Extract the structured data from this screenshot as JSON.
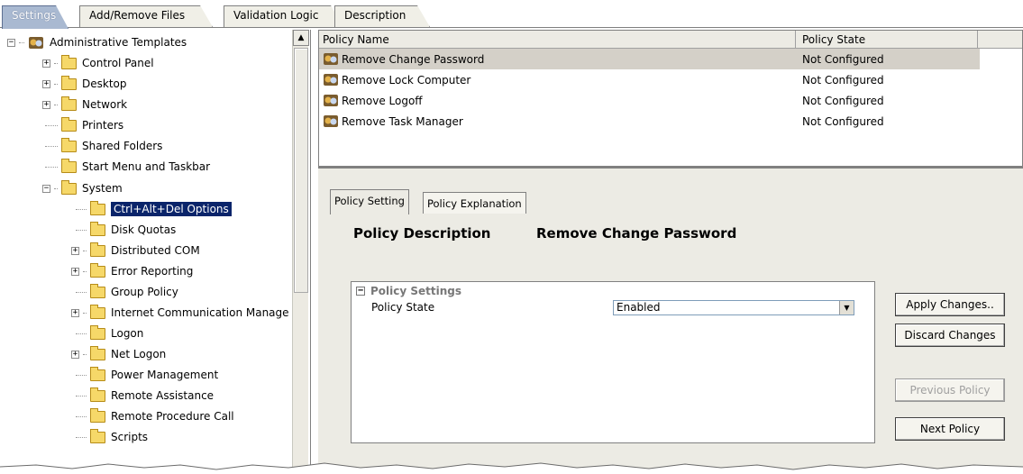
{
  "top_tabs": [
    {
      "label": "Settings",
      "active": true
    },
    {
      "label": "Add/Remove Files",
      "active": false
    },
    {
      "label": "Validation Logic",
      "active": false
    },
    {
      "label": "Description",
      "active": false
    }
  ],
  "tree": {
    "root": "Administrative Templates",
    "items": [
      {
        "label": "Control Panel",
        "expandable": true
      },
      {
        "label": "Desktop",
        "expandable": true
      },
      {
        "label": "Network",
        "expandable": true
      },
      {
        "label": "Printers",
        "expandable": false
      },
      {
        "label": "Shared Folders",
        "expandable": false
      },
      {
        "label": "Start Menu and Taskbar",
        "expandable": false
      },
      {
        "label": "System",
        "expandable": true,
        "expanded": true
      },
      {
        "label": "Ctrl+Alt+Del Options",
        "selected": true
      },
      {
        "label": "Disk Quotas"
      },
      {
        "label": "Distributed COM",
        "expandable": true
      },
      {
        "label": "Error Reporting",
        "expandable": true
      },
      {
        "label": "Group Policy"
      },
      {
        "label": "Internet Communication Manage",
        "expandable": true
      },
      {
        "label": "Logon"
      },
      {
        "label": "Net Logon",
        "expandable": true
      },
      {
        "label": "Power Management"
      },
      {
        "label": "Remote Assistance"
      },
      {
        "label": "Remote Procedure Call"
      },
      {
        "label": "Scripts"
      }
    ]
  },
  "policy_list": {
    "columns": [
      "Policy Name",
      "Policy State"
    ],
    "rows": [
      {
        "name": "Remove Change Password",
        "state": "Not Configured",
        "selected": true
      },
      {
        "name": "Remove Lock Computer",
        "state": "Not Configured"
      },
      {
        "name": "Remove Logoff",
        "state": "Not Configured"
      },
      {
        "name": "Remove Task Manager",
        "state": "Not Configured"
      }
    ]
  },
  "detail": {
    "tabs": [
      "Policy Setting",
      "Policy Explanation"
    ],
    "description_label": "Policy Description",
    "description_value": "Remove Change Password",
    "settings_header": "Policy Settings",
    "policy_state_label": "Policy State",
    "policy_state_value": "Enabled"
  },
  "buttons": {
    "apply": "Apply Changes..",
    "discard": "Discard Changes",
    "previous": "Previous Policy",
    "next": "Next Policy"
  },
  "colors": {
    "selection": "#0a246a",
    "folder": "#f6d869",
    "panel": "#ecebe4"
  }
}
